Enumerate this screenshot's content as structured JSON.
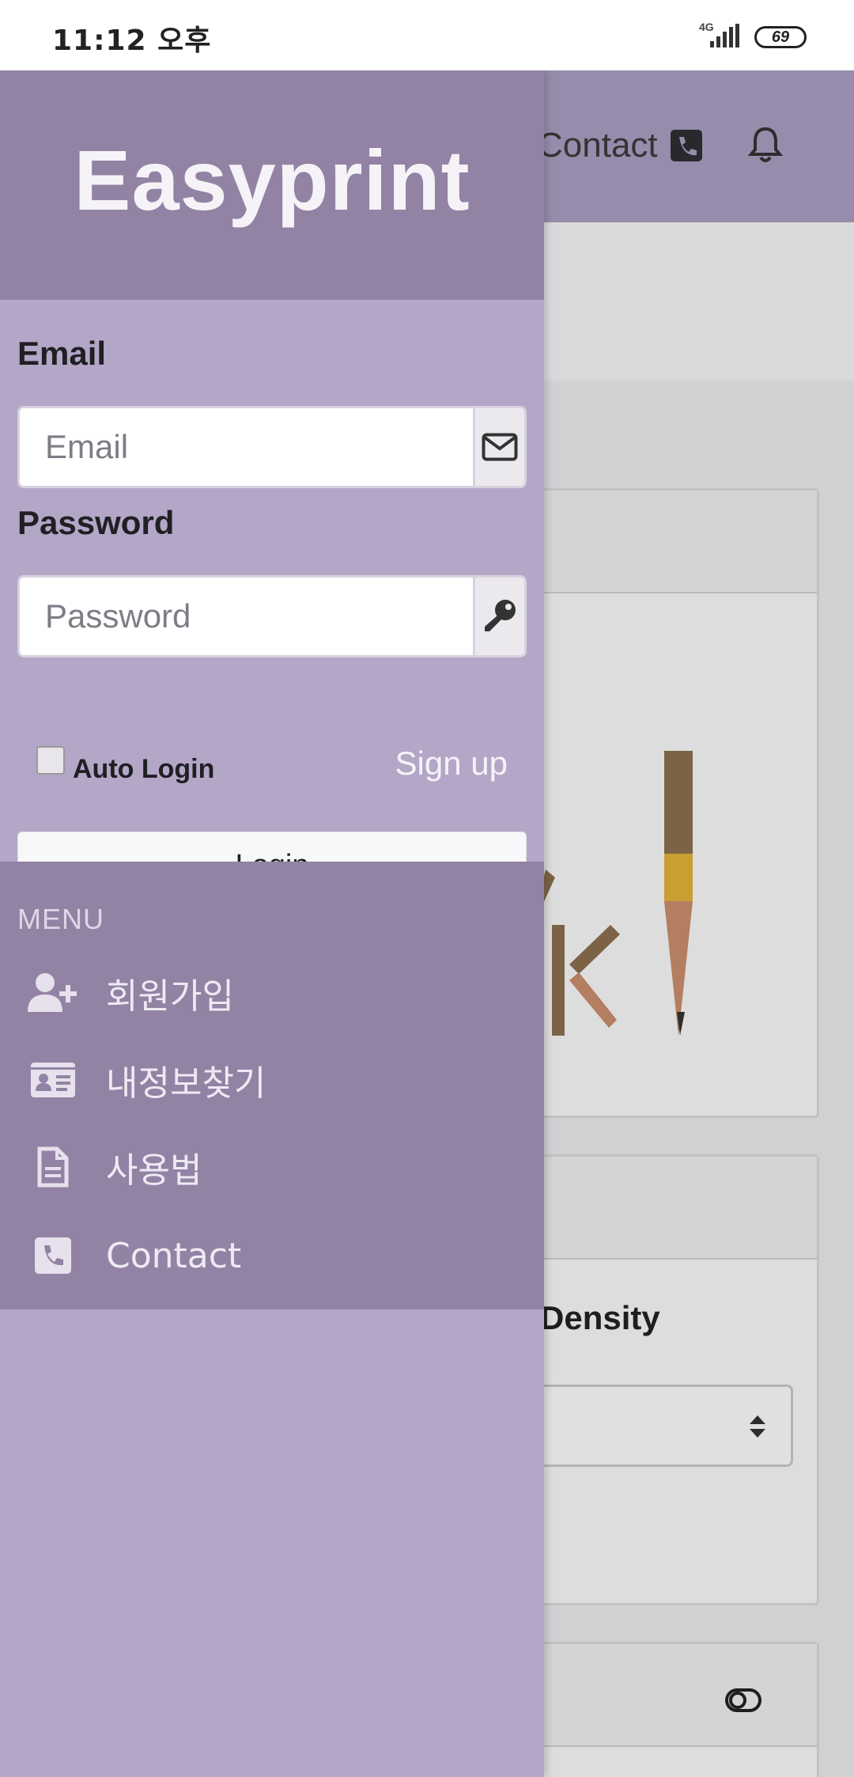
{
  "status_bar": {
    "time": "11:12 오후",
    "network": "4G",
    "battery": "69"
  },
  "background_app": {
    "nav_contact_label": "Contact",
    "density_label": "Density"
  },
  "drawer": {
    "brand": "Easyprint",
    "login": {
      "email_label": "Email",
      "email_placeholder": "Email",
      "email_value": "",
      "password_label": "Password",
      "password_placeholder": "Password",
      "password_value": "",
      "auto_login_label": "Auto Login",
      "auto_login_checked": false,
      "signup_label": "Sign up",
      "login_button": "Login"
    },
    "menu": {
      "title": "MENU",
      "items": [
        {
          "label": "회원가입",
          "icon": "user-plus-icon"
        },
        {
          "label": "내정보찾기",
          "icon": "id-card-icon"
        },
        {
          "label": "사용법",
          "icon": "document-icon"
        },
        {
          "label": "Contact",
          "icon": "phone-icon"
        }
      ]
    }
  },
  "colors": {
    "drawer_header": "#9283a5",
    "drawer_body": "#b4a6c7",
    "brand_text": "#f5f3f7"
  }
}
